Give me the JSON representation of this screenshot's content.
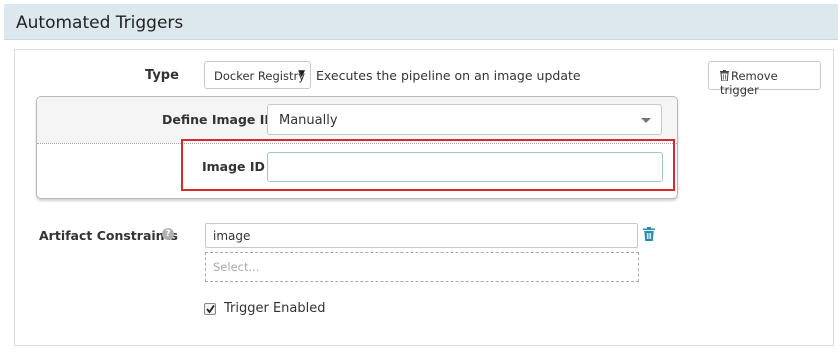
{
  "section": {
    "title": "Automated Triggers"
  },
  "trigger": {
    "type_label": "Type",
    "type_value": "Docker Registry",
    "type_help": "Executes the pipeline on an image update",
    "remove_label": "Remove trigger",
    "define_image_label": "Define Image ID",
    "define_image_value": "Manually",
    "image_id_label": "Image ID",
    "image_id_value": "",
    "artifact_label": "Artifact Constraints",
    "artifact_help_glyph": "?",
    "artifact_tag": "image",
    "artifact_placeholder": "Select...",
    "enabled_label": "Trigger Enabled",
    "enabled": true
  },
  "icons": {
    "type_caret": "caret-down-icon",
    "define_caret": "chevron-down-icon",
    "remove": "trash-icon",
    "artifact_delete": "trash-icon",
    "help": "question-circle-icon",
    "checkbox": "check-icon"
  },
  "colors": {
    "header_bg": "#dce8ee",
    "highlight": "#d52b2b",
    "accent_blue": "#2a8ba8",
    "input_focus_border": "#9cc6d3"
  }
}
